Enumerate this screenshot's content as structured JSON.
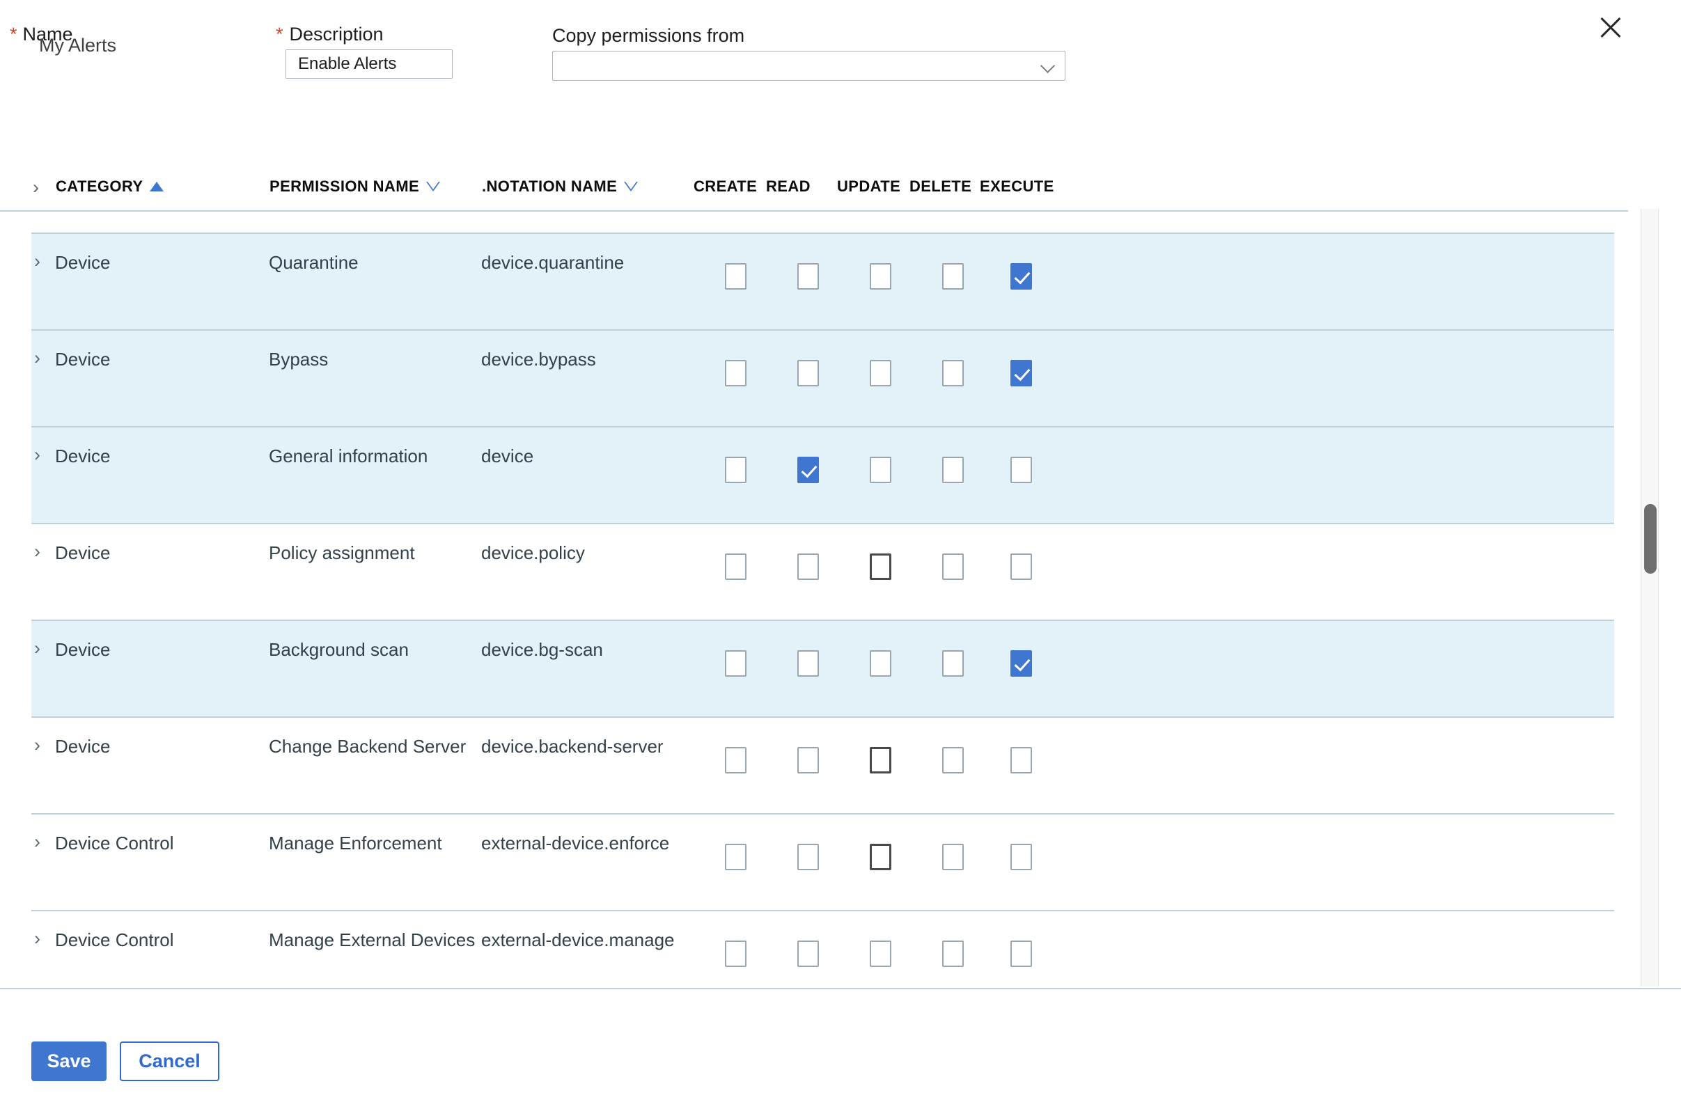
{
  "form": {
    "name": {
      "required_marker": "*",
      "label": "Name",
      "value": "My Alerts"
    },
    "description": {
      "required_marker": "*",
      "label": "Description",
      "value": "Enable Alerts",
      "placeholder": ""
    },
    "copy_permissions": {
      "label": "Copy permissions from",
      "value": "",
      "placeholder": "",
      "chevron": "chevron-down-icon"
    },
    "close_icon": "close-icon"
  },
  "table": {
    "expand_icon": "chevron-right-icon",
    "columns": [
      {
        "key": "category",
        "label": "CATEGORY",
        "sort": "asc",
        "sort_icon": "triangle-up-filled"
      },
      {
        "key": "permission_name",
        "label": "PERMISSION NAME",
        "sort": "none",
        "sort_icon": "triangle-down-outline"
      },
      {
        "key": "notation_name",
        "label": ".NOTATION NAME",
        "sort": "none",
        "sort_icon": "triangle-down-outline"
      },
      {
        "key": "create",
        "label": "CREATE",
        "sort": null,
        "sort_icon": null
      },
      {
        "key": "read",
        "label": "READ",
        "sort": null,
        "sort_icon": null
      },
      {
        "key": "update",
        "label": "UPDATE",
        "sort": null,
        "sort_icon": null
      },
      {
        "key": "delete",
        "label": "DELETE",
        "sort": null,
        "sort_icon": null
      },
      {
        "key": "execute",
        "label": "EXECUTE",
        "sort": null,
        "sort_icon": null
      }
    ],
    "rows": [
      {
        "category": "Device",
        "permission_name": "Quarantine",
        "notation_name": "device.quarantine",
        "create": false,
        "read": false,
        "update": false,
        "delete": false,
        "execute": true,
        "selected": true,
        "focus_cell": null
      },
      {
        "category": "Device",
        "permission_name": "Bypass",
        "notation_name": "device.bypass",
        "create": false,
        "read": false,
        "update": false,
        "delete": false,
        "execute": true,
        "selected": true,
        "focus_cell": null
      },
      {
        "category": "Device",
        "permission_name": "General information",
        "notation_name": "device",
        "create": false,
        "read": true,
        "update": false,
        "delete": false,
        "execute": false,
        "selected": true,
        "focus_cell": null
      },
      {
        "category": "Device",
        "permission_name": "Policy assignment",
        "notation_name": "device.policy",
        "create": false,
        "read": false,
        "update": false,
        "delete": false,
        "execute": false,
        "selected": false,
        "focus_cell": "update"
      },
      {
        "category": "Device",
        "permission_name": "Background scan",
        "notation_name": "device.bg-scan",
        "create": false,
        "read": false,
        "update": false,
        "delete": false,
        "execute": true,
        "selected": true,
        "focus_cell": null
      },
      {
        "category": "Device",
        "permission_name": "Change Backend Server",
        "notation_name": "device.backend-server",
        "create": false,
        "read": false,
        "update": false,
        "delete": false,
        "execute": false,
        "selected": false,
        "focus_cell": "update"
      },
      {
        "category": "Device Control",
        "permission_name": "Manage Enforcement",
        "notation_name": "external-device.enforce",
        "create": false,
        "read": false,
        "update": false,
        "delete": false,
        "execute": false,
        "selected": false,
        "focus_cell": "update"
      },
      {
        "category": "Device Control",
        "permission_name": "Manage External Devices",
        "notation_name": "external-device.manage",
        "create": false,
        "read": false,
        "update": false,
        "delete": false,
        "execute": false,
        "selected": false,
        "focus_cell": null
      }
    ]
  },
  "footer": {
    "save_label": "Save",
    "cancel_label": "Cancel"
  },
  "colors": {
    "accent": "#3f76cf",
    "selected_row": "#e3f1f8",
    "border": "#c3d0d6",
    "required": "#d93f21",
    "text": "#33424a"
  }
}
